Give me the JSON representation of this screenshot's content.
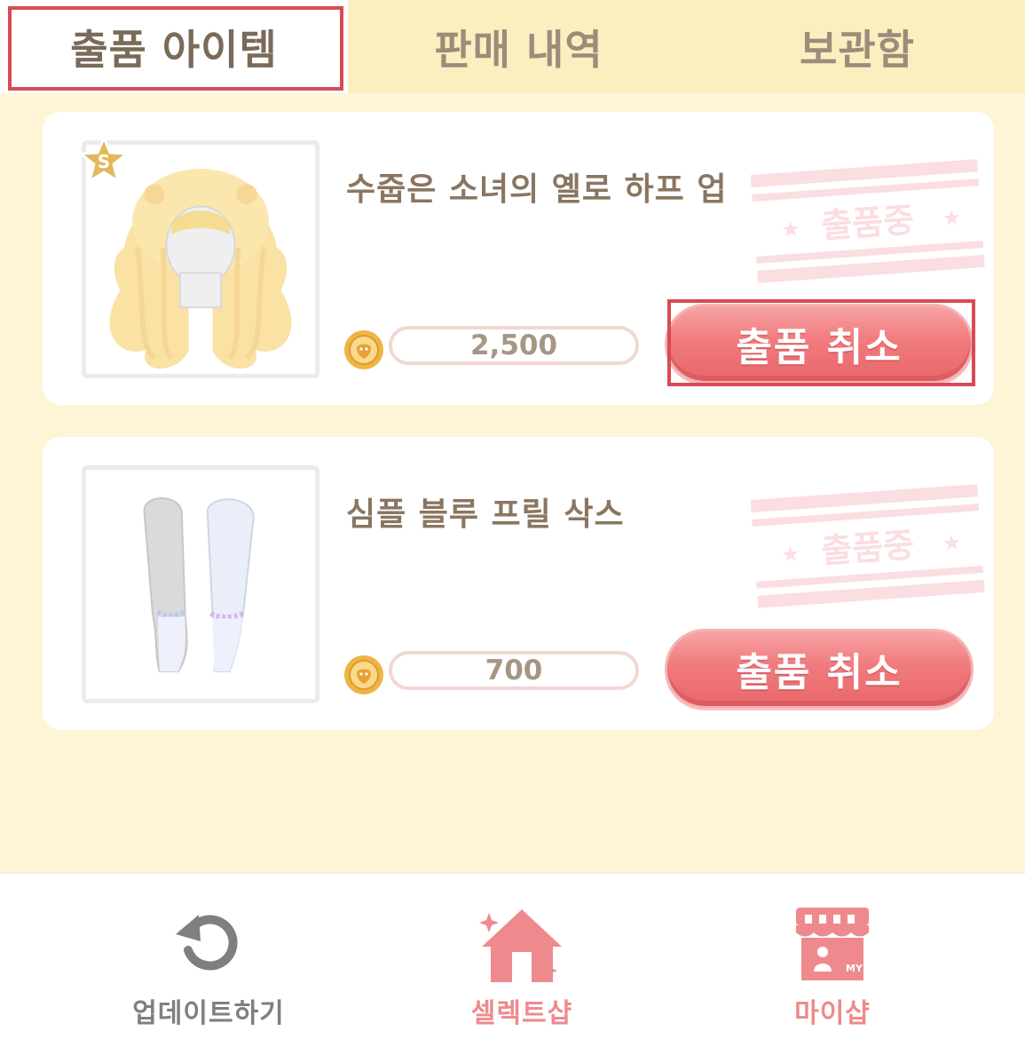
{
  "tabs": [
    {
      "label": "출품 아이템",
      "active": true
    },
    {
      "label": "판매 내역",
      "active": false
    },
    {
      "label": "보관함",
      "active": false
    }
  ],
  "items": [
    {
      "name": "수줍은 소녀의 옐로 하프 업",
      "price": "2,500",
      "grade": "S",
      "status_stamp": "출품중",
      "cancel_label": "출품 취소",
      "thumbnail_icon": "yellow-half-up-hair-icon"
    },
    {
      "name": "심플 블루 프릴 삭스",
      "price": "700",
      "status_stamp": "출품중",
      "cancel_label": "출품 취소",
      "thumbnail_icon": "blue-frill-socks-icon"
    }
  ],
  "bottom_nav": [
    {
      "label": "업데이트하기",
      "icon": "refresh-icon"
    },
    {
      "label": "셀렉트샵",
      "icon": "house-icon"
    },
    {
      "label": "마이샵",
      "icon": "my-shop-icon"
    }
  ],
  "colors": {
    "background": "#fdf5d6",
    "tab_bar": "#fbefc0",
    "accent_red": "#ee7a7e",
    "highlight_border": "#d84a55",
    "text_brown": "#8a7660"
  }
}
